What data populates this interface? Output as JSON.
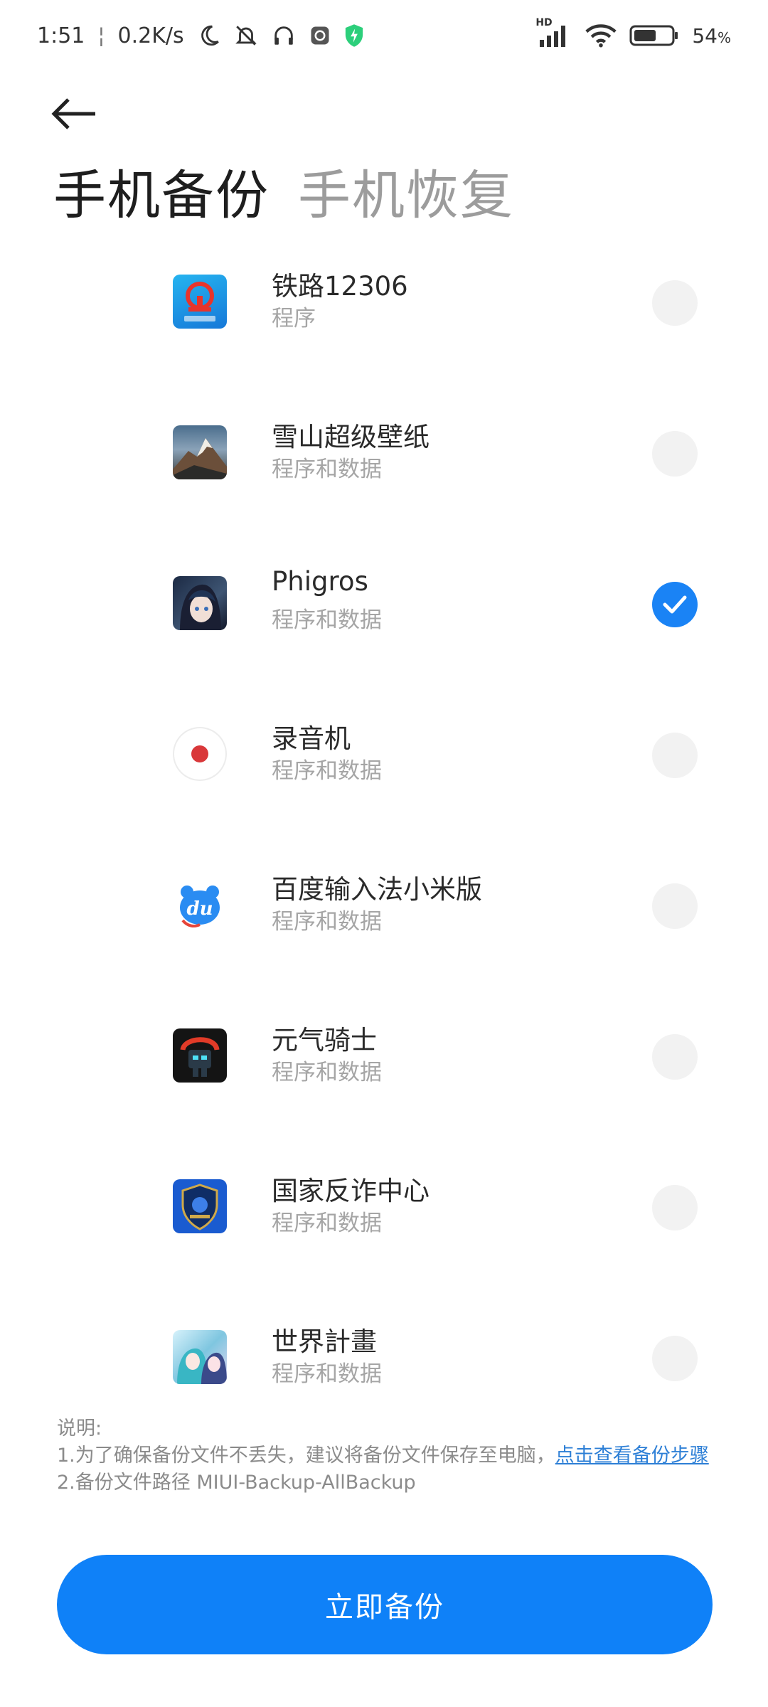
{
  "status_bar": {
    "time": "1:51",
    "speed": "0.2K/s",
    "battery": "54",
    "battery_unit": "%",
    "hd_label": "HD"
  },
  "tabs": [
    {
      "label": "手机备份",
      "active": true
    },
    {
      "label": "手机恢复",
      "active": false
    }
  ],
  "apps": [
    {
      "name": "铁路12306",
      "sub": "程序",
      "checked": false,
      "icon": "rail-12306-icon"
    },
    {
      "name": "雪山超级壁纸",
      "sub": "程序和数据",
      "checked": false,
      "icon": "snow-mountain-wallpaper-icon"
    },
    {
      "name": "Phigros",
      "sub": "程序和数据",
      "checked": true,
      "icon": "phigros-icon"
    },
    {
      "name": "录音机",
      "sub": "程序和数据",
      "checked": false,
      "icon": "recorder-icon"
    },
    {
      "name": "百度输入法小米版",
      "sub": "程序和数据",
      "checked": false,
      "icon": "baidu-input-icon"
    },
    {
      "name": "元气骑士",
      "sub": "程序和数据",
      "checked": false,
      "icon": "soul-knight-icon"
    },
    {
      "name": "国家反诈中心",
      "sub": "程序和数据",
      "checked": false,
      "icon": "anti-fraud-icon"
    },
    {
      "name": "世界計畫",
      "sub": "程序和数据",
      "checked": false,
      "icon": "project-sekai-icon"
    }
  ],
  "notes": {
    "title": "说明:",
    "line1": "1.为了确保备份文件不丢失，建议将备份文件保存至电脑，",
    "line1_link": "点击查看备份步骤",
    "line2": "2.备份文件路径 MIUI-Backup-AllBackup"
  },
  "primary_button": "立即备份",
  "colors": {
    "accent": "#0f81f8",
    "check": "#1a83f5",
    "link": "#2d7fd6"
  }
}
